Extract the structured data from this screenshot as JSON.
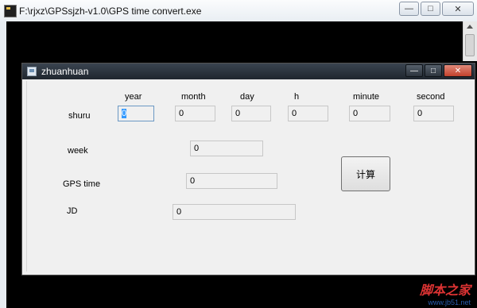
{
  "console": {
    "title": "F:\\rjxz\\GPSsjzh-v1.0\\GPS time convert.exe",
    "buttons": {
      "minimize": "—",
      "maximize": "□",
      "close": "✕"
    }
  },
  "dialog": {
    "title": "zhuanhuan",
    "buttons": {
      "minimize": "—",
      "maximize": "□",
      "close": "✕"
    },
    "columns": [
      "year",
      "month",
      "day",
      "h",
      "minute",
      "second"
    ],
    "rows": {
      "shuru": {
        "label": "shuru",
        "values": [
          "0",
          "0",
          "0",
          "0",
          "0",
          "0"
        ]
      },
      "week": {
        "label": "week",
        "value": "0"
      },
      "gps_time": {
        "label": "GPS time",
        "value": "0"
      },
      "jd": {
        "label": "JD",
        "value": "0"
      }
    },
    "calc_button": "计算"
  },
  "watermark": {
    "main": "脚本之家",
    "url": "www.jb51.net"
  }
}
